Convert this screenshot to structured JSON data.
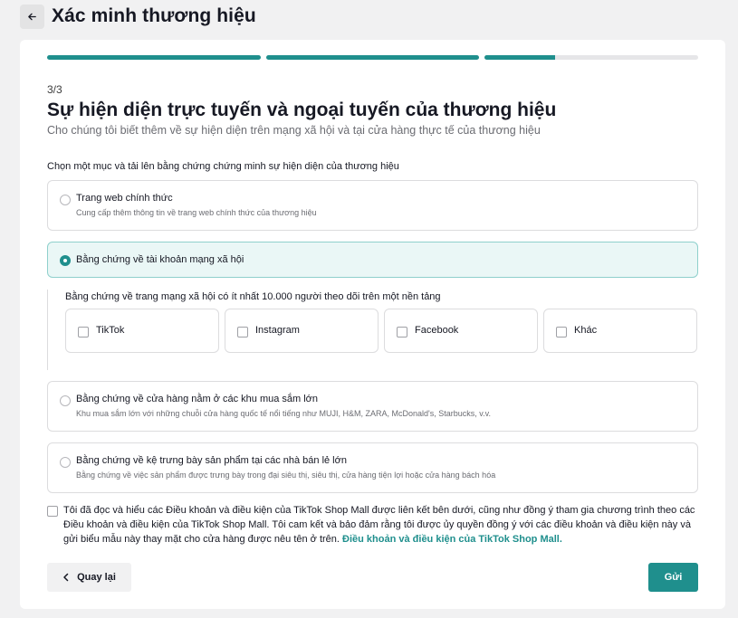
{
  "header": {
    "title": "Xác minh thương hiệu",
    "back_icon": "arrow-left-icon"
  },
  "progress": {
    "segments": [
      1,
      1,
      0.33
    ],
    "color": "#1f8f8d"
  },
  "step": "3/3",
  "title": "Sự hiện diện trực tuyến và ngoại tuyến của thương hiệu",
  "subtitle": "Cho chúng tôi biết thêm về sự hiện diện trên mạng xã hội và tại cửa hàng thực tế của thương hiệu",
  "prompt": "Chọn một mục và tải lên bằng chứng chứng minh sự hiện diện của thương hiệu",
  "options": [
    {
      "label": "Trang web chính thức",
      "desc": "Cung cấp thêm thông tin về trang web chính thức của thương hiệu",
      "selected": false
    },
    {
      "label": "Bằng chứng về tài khoản mạng xã hội",
      "selected": true
    },
    {
      "label": "Bằng chứng về cửa hàng nằm ở các khu mua sắm lớn",
      "desc": "Khu mua sắm lớn với những chuỗi cửa hàng quốc tế nổi tiếng như MUJI, H&M, ZARA, McDonald's, Starbucks, v.v.",
      "selected": false
    },
    {
      "label": "Bằng chứng về kệ trưng bày sản phẩm tại các nhà bán lẻ lớn",
      "desc": "Bằng chứng về việc sản phẩm được trưng bày trong đại siêu thị, siêu thị, cửa hàng tiện lợi hoặc cửa hàng bách hóa",
      "selected": false
    }
  ],
  "social": {
    "title": "Bằng chứng về trang mạng xã hội có ít nhất 10.000 người theo dõi trên một nền tảng",
    "platforms": [
      {
        "label": "TikTok",
        "checked": false
      },
      {
        "label": "Instagram",
        "checked": false
      },
      {
        "label": "Facebook",
        "checked": false
      },
      {
        "label": "Khác",
        "checked": false
      }
    ]
  },
  "terms": {
    "text": "Tôi đã đọc và hiểu các Điều khoản và điều kiện của TikTok Shop Mall được liên kết bên dưới, cũng như đồng ý tham gia chương trình theo các Điều khoản và điều kiện của TikTok Shop Mall. Tôi cam kết và bảo đảm rằng tôi được ủy quyền đồng ý với các điều khoản và điều kiện này và gửi biểu mẫu này thay mặt cho cửa hàng được nêu tên ở trên.",
    "link": "Điều khoản và điều kiện của TikTok Shop Mall.",
    "checked": false
  },
  "buttons": {
    "back": "Quay lại",
    "back_icon": "chevron-left-icon",
    "submit": "Gửi"
  },
  "colors": {
    "accent": "#1f8f8d",
    "selected_bg": "#eaf7f6",
    "selected_border": "#8fd0cc"
  }
}
